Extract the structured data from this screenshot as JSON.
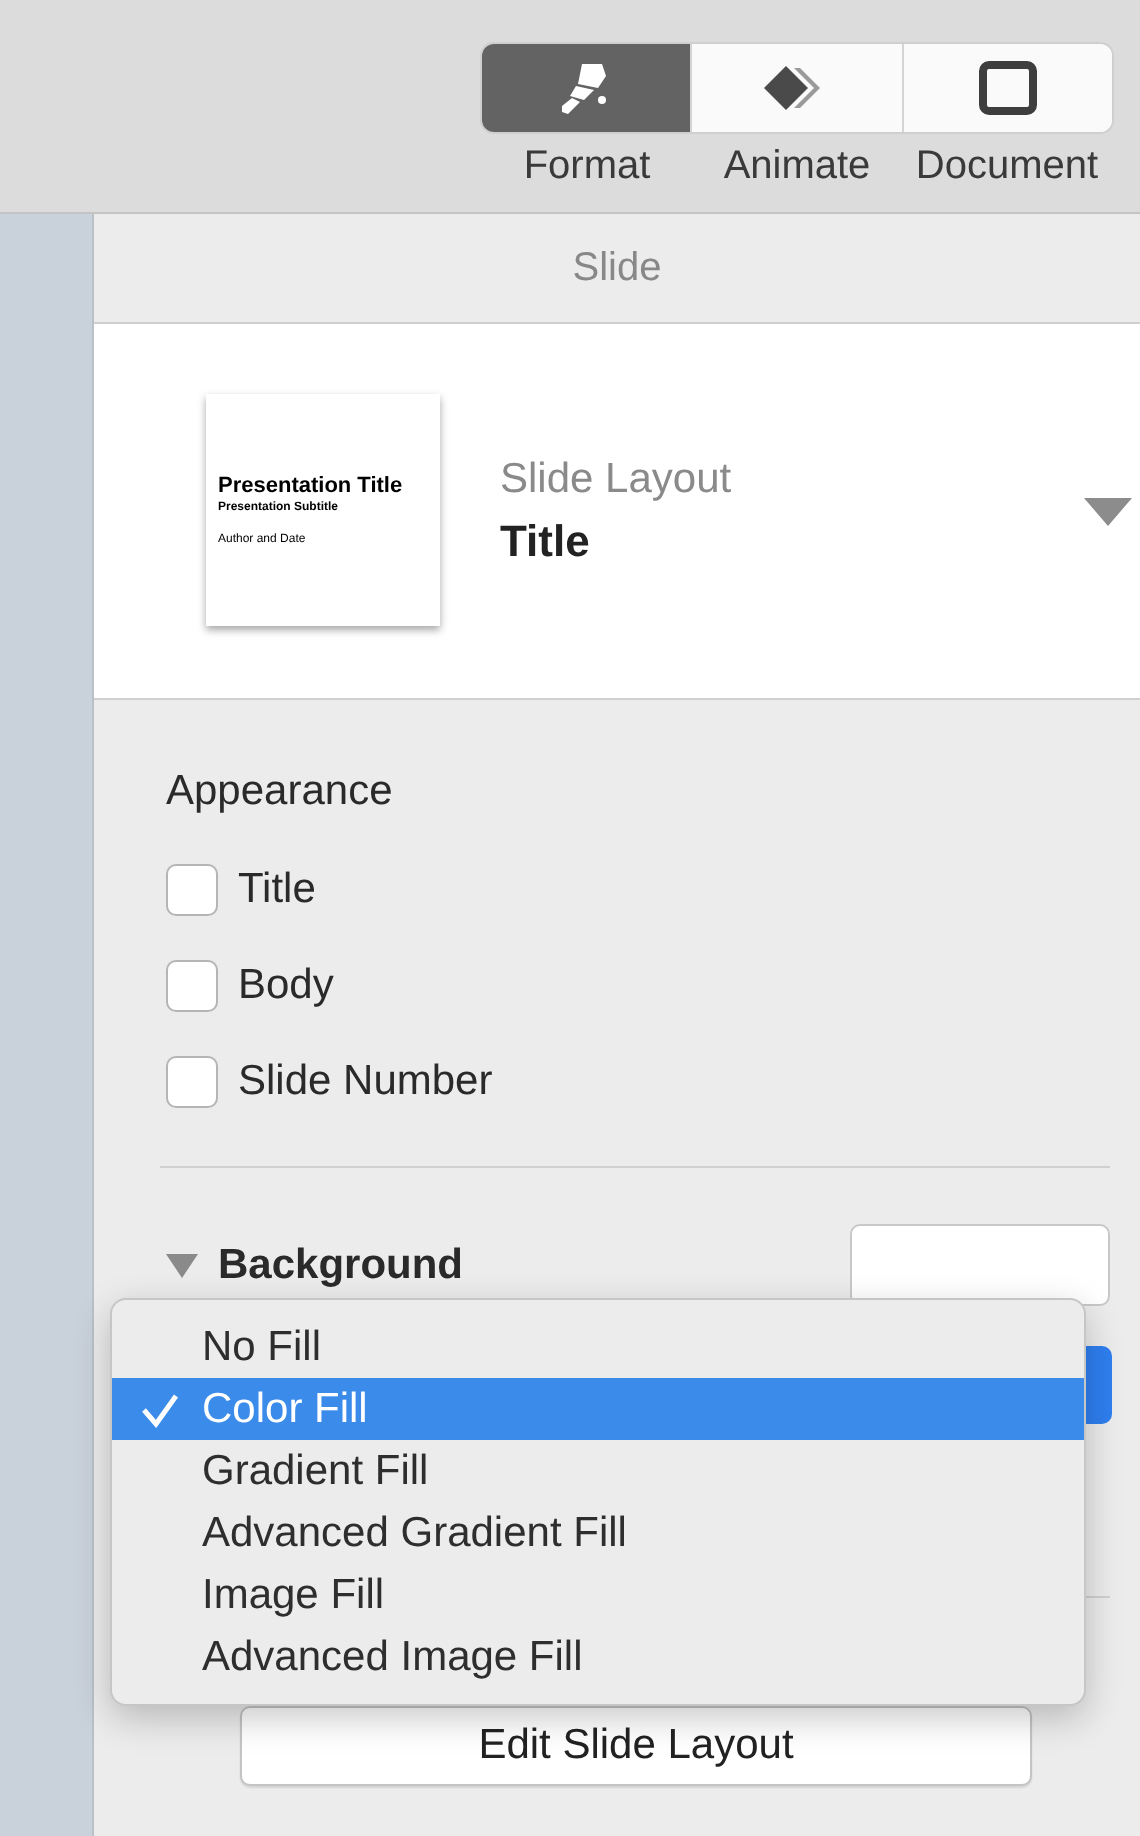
{
  "toolbar": {
    "tabs": [
      {
        "label": "Format",
        "selected": true
      },
      {
        "label": "Animate",
        "selected": false
      },
      {
        "label": "Document",
        "selected": false
      }
    ]
  },
  "panel": {
    "header": "Slide",
    "layout": {
      "thumbnail": {
        "title": "Presentation Title",
        "subtitle": "Presentation Subtitle",
        "footer": "Author and Date"
      },
      "label": "Slide Layout",
      "value": "Title"
    },
    "appearance": {
      "title": "Appearance",
      "options": [
        {
          "label": "Title",
          "checked": false
        },
        {
          "label": "Body",
          "checked": false
        },
        {
          "label": "Slide Number",
          "checked": false
        }
      ]
    },
    "background": {
      "label": "Background",
      "expanded": true
    },
    "edit_button": "Edit Slide Layout"
  },
  "fill_menu": {
    "items": [
      {
        "label": "No Fill",
        "selected": false
      },
      {
        "label": "Color Fill",
        "selected": true
      },
      {
        "label": "Gradient Fill",
        "selected": false
      },
      {
        "label": "Advanced Gradient Fill",
        "selected": false
      },
      {
        "label": "Image Fill",
        "selected": false
      },
      {
        "label": "Advanced Image Fill",
        "selected": false
      }
    ]
  }
}
